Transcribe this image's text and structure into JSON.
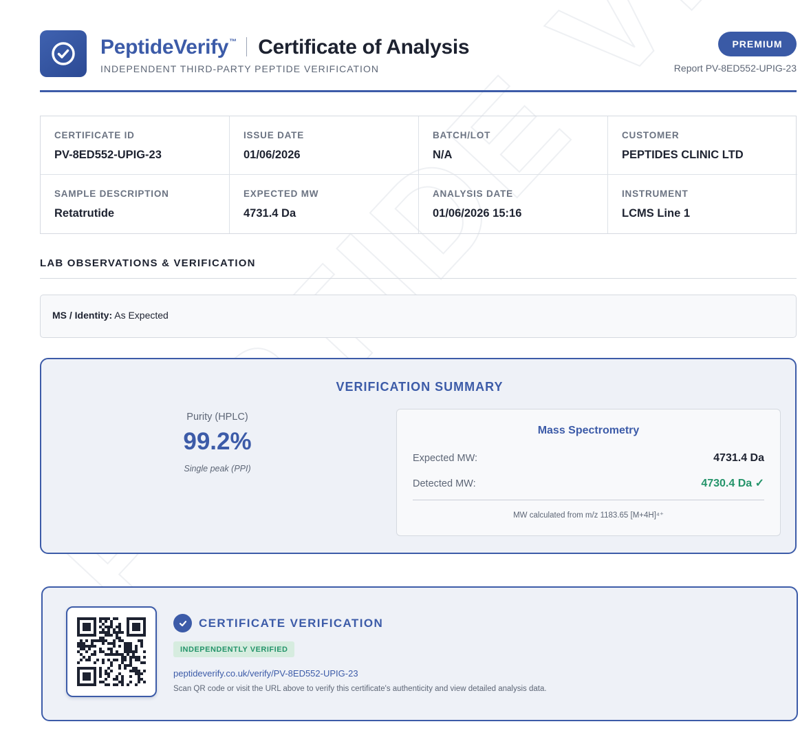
{
  "watermark": {
    "text": "PEPTIDE VERIFY"
  },
  "header": {
    "brand": "PeptideVerify",
    "trademark": "™",
    "document_title": "Certificate of Analysis",
    "tagline": "INDEPENDENT THIRD-PARTY PEPTIDE VERIFICATION",
    "tier_badge": "PREMIUM",
    "report_id": "Report PV-8ED552-UPIG-23",
    "logo_icon": "check-circle-icon"
  },
  "info": [
    {
      "label": "CERTIFICATE ID",
      "value": "PV-8ED552-UPIG-23"
    },
    {
      "label": "ISSUE DATE",
      "value": "01/06/2026"
    },
    {
      "label": "BATCH/LOT",
      "value": "N/A"
    },
    {
      "label": "CUSTOMER",
      "value": "PEPTIDES CLINIC LTD"
    },
    {
      "label": "SAMPLE DESCRIPTION",
      "value": "Retatrutide"
    },
    {
      "label": "EXPECTED MW",
      "value": "4731.4 Da"
    },
    {
      "label": "ANALYSIS DATE",
      "value": "01/06/2026 15:16"
    },
    {
      "label": "INSTRUMENT",
      "value": "LCMS Line 1"
    }
  ],
  "observations": {
    "title": "LAB OBSERVATIONS & VERIFICATION",
    "label": "MS / Identity:",
    "value": " As Expected"
  },
  "summary": {
    "title": "VERIFICATION SUMMARY",
    "purity_label": "Purity (HPLC)",
    "purity_value": "99.2%",
    "purity_note": "Single peak (PPI)",
    "ms": {
      "title": "Mass Spectrometry",
      "expected_label": "Expected MW:",
      "expected_value": "4731.4 Da",
      "detected_label": "Detected MW:",
      "detected_value": "4730.4 Da ✓",
      "note": "MW calculated from m/z 1183.65 [M+4H]⁴⁺"
    }
  },
  "verification": {
    "title": "CERTIFICATE VERIFICATION",
    "badge": "INDEPENDENTLY VERIFIED",
    "url": "peptideverify.co.uk/verify/PV-8ED552-UPIG-23",
    "note": "Scan QR code or visit the URL above to verify this certificate's authenticity and view detailed analysis data.",
    "qr_icon": "qr-code-icon"
  },
  "colors": {
    "brand_blue": "#3c5ba8",
    "success_green": "#24946a",
    "panel_bg": "#eef1f7"
  }
}
